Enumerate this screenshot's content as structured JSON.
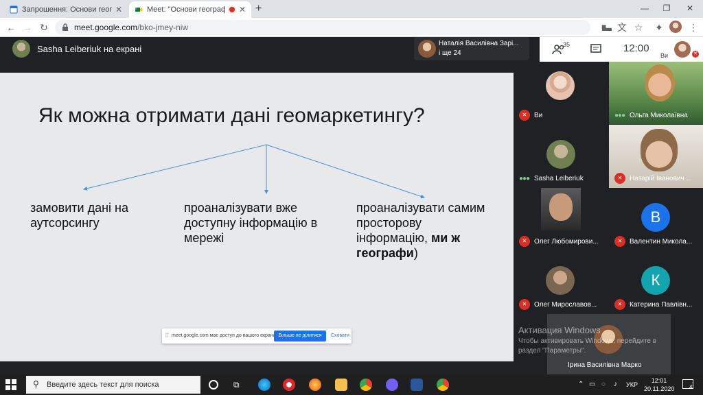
{
  "browser": {
    "tabs": [
      {
        "title": "Запрошення: Основи географіч",
        "active": false
      },
      {
        "title": "Meet: \"Основи географічно",
        "active": true
      }
    ],
    "new_tab": "+",
    "url_host": "meet.google.com",
    "url_path": "/bko-jmey-niw"
  },
  "meet": {
    "presenter_label": "Sasha Leiberiuk на екрані",
    "people_line1": "Наталія Василівна Зарі...",
    "people_line2": "і ще 24",
    "participant_count": "35",
    "clock": "12:00",
    "you_label": "Ви"
  },
  "slide": {
    "title": "Як можна отримати дані геомаркетингу?",
    "col1": "замовити дані на аутсорсингу",
    "col2": "проаналізувати вже доступну інформацію в мережі",
    "col3_plain": "проаналізувати самим просторову інформацію, ",
    "col3_bold": "ми ж географи",
    "col3_end": ")"
  },
  "share_banner": {
    "handle": "⠿",
    "message": "meet.google.com має доступ до вашого екрана.",
    "stop_label": "Більше не ділитися",
    "hide_label": "Сховати"
  },
  "tiles": [
    {
      "name": "Ви",
      "mic": "off",
      "kind": "avatar-photo",
      "color": "#e8c2b0"
    },
    {
      "name": "Ольга Миколаївна",
      "mic": "speaking",
      "kind": "video",
      "color": "#5a8a4a"
    },
    {
      "name": "Sasha Leiberiuk",
      "mic": "speaking",
      "kind": "avatar-photo",
      "color": "#6f7f52"
    },
    {
      "name": "Назарій Іванович ...",
      "mic": "off",
      "kind": "video",
      "color": "#8c7a6a"
    },
    {
      "name": "Олег Любомирови...",
      "mic": "off",
      "kind": "video",
      "color": "#3a3a3a"
    },
    {
      "name": "Валентин Микола...",
      "mic": "off",
      "kind": "initial",
      "initial": "В",
      "color": "#1a73e8"
    },
    {
      "name": "Олег Мирославов...",
      "mic": "off",
      "kind": "avatar-photo",
      "color": "#7a6650"
    },
    {
      "name": "Катерина Павлівн...",
      "mic": "off",
      "kind": "initial",
      "initial": "К",
      "color": "#12a4af"
    },
    {
      "name": "Ірина Василівна Марко",
      "mic": "none",
      "kind": "avatar-photo",
      "color": "#c89a7a"
    }
  ],
  "activation": {
    "line1": "Активация Windows",
    "line2": "Чтобы активировать Windows, перейдите в",
    "line3": "раздел \"Параметры\"."
  },
  "taskbar": {
    "search_placeholder": "Введите здесь текст для поиска",
    "lang": "УКР",
    "time": "12:01",
    "date": "20.11.2020",
    "notifications": "4"
  }
}
